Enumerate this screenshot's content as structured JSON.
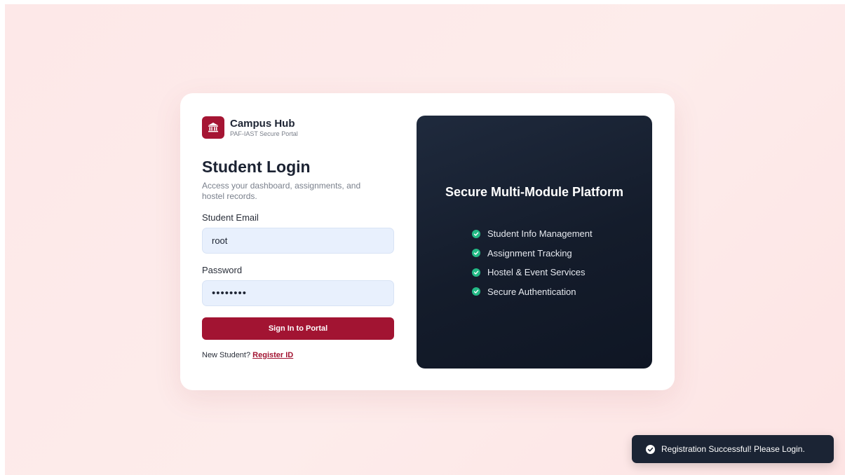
{
  "brand": {
    "name": "Campus Hub",
    "subtitle": "PAF-IAST Secure Portal",
    "logo_icon": "bank-building-icon",
    "color": "#a51533"
  },
  "login": {
    "title": "Student Login",
    "description": "Access your dashboard, assignments, and hostel records.",
    "email_label": "Student Email",
    "email_value": "root",
    "password_label": "Password",
    "password_value": "••••••••",
    "submit_label": "Sign In to Portal",
    "register_prompt": "New Student?",
    "register_link": "Register ID"
  },
  "panel": {
    "title": "Secure Multi-Module Platform",
    "features": [
      "Student Info Management",
      "Assignment Tracking",
      "Hostel & Event Services",
      "Secure Authentication"
    ],
    "check_color": "#23b985"
  },
  "toast": {
    "message": "Registration Successful! Please Login.",
    "icon": "check-circle-icon"
  }
}
